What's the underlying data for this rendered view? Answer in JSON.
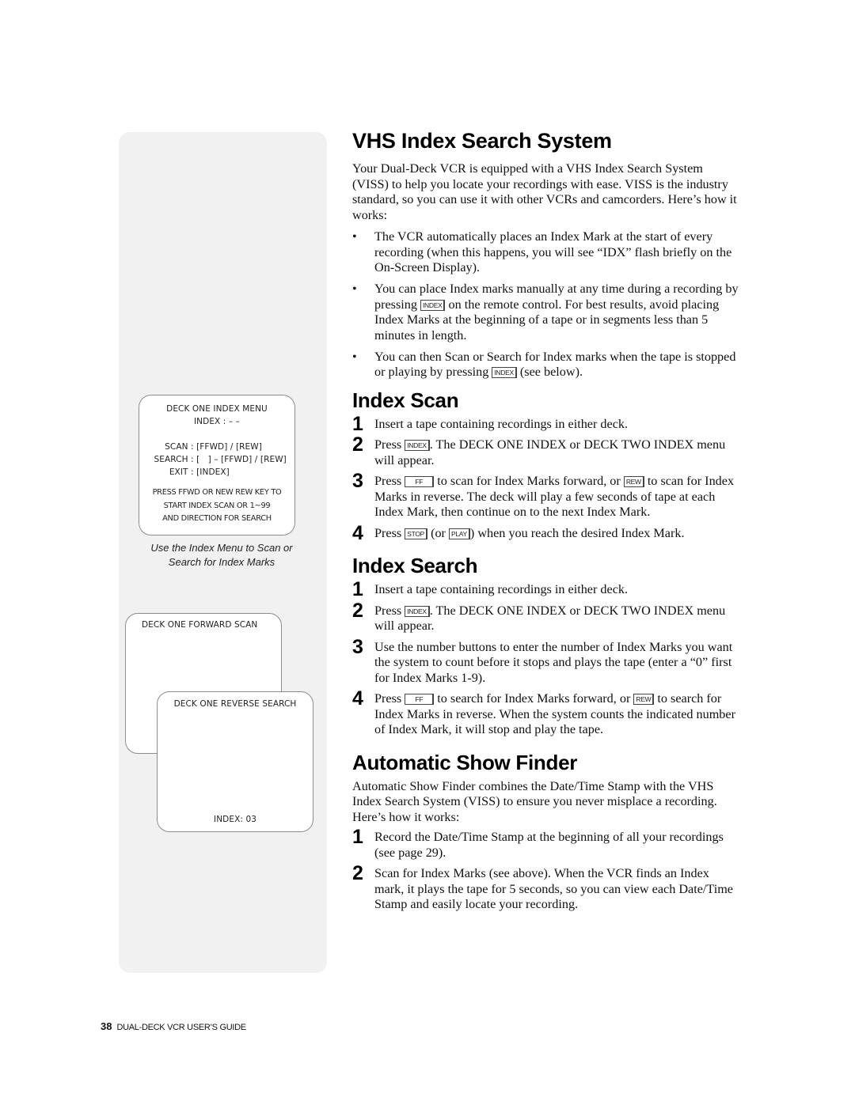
{
  "sidebar": {
    "index_menu": {
      "title": "DECK ONE INDEX MENU",
      "index_line": "INDEX : – –",
      "rows": [
        {
          "label": "SCAN : ",
          "value": "[FFWD] / [REW]"
        },
        {
          "label": "SEARCH : ",
          "value": "[   ] – [FFWD] / [REW]"
        },
        {
          "label": "EXIT : ",
          "value": "[INDEX]"
        }
      ],
      "press_lines": [
        "PRESS FFWD OR NEW REW KEY TO",
        "START INDEX SCAN OR 1~99",
        "AND DIRECTION FOR SEARCH"
      ]
    },
    "caption_lines": [
      "Use the Index Menu to Scan or",
      "Search for Index Marks"
    ],
    "forward_scan": {
      "title": "DECK ONE FORWARD SCAN"
    },
    "reverse_search": {
      "title": "DECK ONE REVERSE SEARCH",
      "index": "INDEX: 03"
    }
  },
  "keys": {
    "index": "INDEX",
    "ff": "FF",
    "rew": "REW",
    "stop": "STOP",
    "play": "PLAY"
  },
  "vhs": {
    "title": "VHS Index Search System",
    "intro": "Your Dual-Deck VCR is equipped with a VHS Index Search System (VISS) to help you locate your recordings with ease. VISS is the industry standard, so you can use it with other VCRs and camcorders. Here’s how it works:",
    "bullet_symbol": "•",
    "bullet1": "The VCR automatically places an Index Mark at the start of every recording (when this happens, you will see “IDX” flash briefly on the On-Screen Display).",
    "bullet2_a": "You can place Index marks manually at any time during a recording by pressing ",
    "bullet2_b": " on the remote control. For best results, avoid placing Index Marks at the beginning of a tape or in segments less than 5 minutes in length.",
    "bullet3_a": "You can then Scan or Search for Index marks when the tape is stopped or playing by pressing ",
    "bullet3_b": " (see below)."
  },
  "index_scan": {
    "title": "Index Scan",
    "step1": {
      "num": "1",
      "text": "Insert a tape containing recordings in either deck."
    },
    "step2": {
      "num": "2",
      "a": "Press ",
      "b": ". The DECK ONE INDEX or DECK TWO INDEX menu will appear."
    },
    "step3": {
      "num": "3",
      "a": "Press ",
      "b": " to scan for Index Marks forward, or ",
      "c": " to scan for Index Marks in reverse. The deck will play a few seconds of tape at each Index Mark, then continue on to the next Index Mark."
    },
    "step4": {
      "num": "4",
      "a": "Press ",
      "b": " (or ",
      "c": ") when you reach the desired Index Mark."
    }
  },
  "index_search": {
    "title": "Index Search",
    "step1": {
      "num": "1",
      "text": "Insert a tape containing recordings in either deck."
    },
    "step2": {
      "num": "2",
      "a": "Press ",
      "b": ". The DECK ONE INDEX or DECK TWO INDEX menu will appear."
    },
    "step3": {
      "num": "3",
      "text": "Use the number buttons to enter the number of Index Marks you want the system to count before it stops and plays the tape (enter a “0” first for Index Marks 1-9)."
    },
    "step4": {
      "num": "4",
      "a": "Press ",
      "b": " to search for Index Marks forward, or ",
      "c": " to search for Index Marks in reverse. When the system counts the indicated number of Index Mark, it will stop and play the tape."
    }
  },
  "show_finder": {
    "title": "Automatic Show Finder",
    "intro": "Automatic Show Finder combines the Date/Time Stamp with the VHS Index Search System (VISS) to ensure you never misplace a recording. Here’s how it works:",
    "step1": {
      "num": "1",
      "text": "Record the Date/Time Stamp at the beginning of all your recordings (see page 29)."
    },
    "step2": {
      "num": "2",
      "text": "Scan for Index Marks (see above). When the VCR finds an Index mark, it plays the tape for 5 seconds, so you can view each Date/Time Stamp and easily locate your recording."
    }
  },
  "footer": {
    "page_number": "38",
    "guide_title": "DUAL-DECK VCR USER’S GUIDE"
  }
}
